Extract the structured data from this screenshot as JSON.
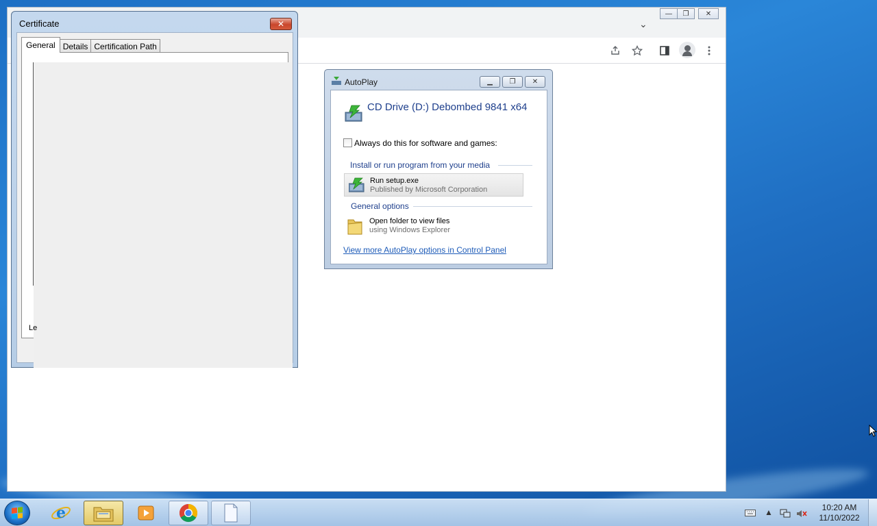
{
  "certificate_dialog": {
    "title": "Certificate",
    "close_glyph": "✕",
    "tabs": [
      "General",
      "Details",
      "Certification Path"
    ],
    "active_tab": "General",
    "truncated_label": "Le"
  },
  "autoplay_dialog": {
    "title": "AutoPlay",
    "drive_label": "CD Drive (D:) Debombed 9841 x64",
    "always_checkbox": {
      "label": "Always do this for software and games:",
      "checked": false
    },
    "install_section": {
      "heading": "Install or run program from your media",
      "item": {
        "title": "Run setup.exe",
        "subtitle": "Published by Microsoft Corporation"
      }
    },
    "general_section": {
      "heading": "General options",
      "item": {
        "title": "Open folder to view files",
        "subtitle": "using Windows Explorer"
      }
    },
    "link": "View more AutoPlay options in Control Panel",
    "controls": {
      "minimize": "▁",
      "maximize": "❐",
      "close": "✕"
    }
  },
  "browser": {
    "window_controls": {
      "minimize": "—",
      "restore": "❐",
      "close": "✕"
    },
    "toolbar_icons": [
      "share-icon",
      "star-icon",
      "side-panel-icon",
      "profile-icon",
      "menu-icon"
    ]
  },
  "taskbar": {
    "pinned": [
      "internet-explorer-icon",
      "windows-explorer-icon",
      "media-player-icon",
      "chrome-icon",
      "document-icon"
    ],
    "active_item": "windows-explorer-icon",
    "tray": [
      "keyboard-icon",
      "show-hidden-icons",
      "network-icon",
      "volume-muted-icon"
    ],
    "clock": {
      "time": "10:20 AM",
      "date": "11/10/2022"
    }
  },
  "colors": {
    "desktop": "#1f6ec2",
    "link": "#1d5bb8",
    "heading_blue": "#1e3f8c",
    "close_red": "#c9462c"
  }
}
